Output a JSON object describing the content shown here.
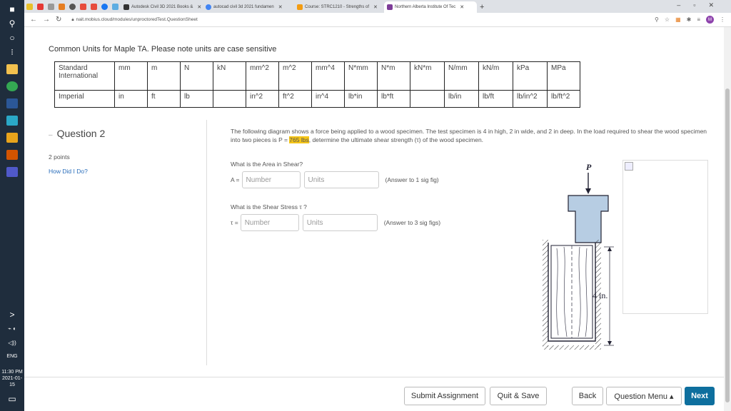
{
  "taskbar": {
    "icons": [
      "windows-start",
      "search",
      "task-view",
      "apps-grid",
      "file-explorer",
      "chrome",
      "word",
      "civil3d",
      "pdf",
      "store",
      "teams"
    ],
    "tray_chevron": ">",
    "lang": "ENG",
    "time": "11:30 PM",
    "date": "2021-01-15"
  },
  "browser": {
    "tabs": [
      {
        "label": "Autodesk Civil 3D 2021 Books &"
      },
      {
        "label": "autocad civil 3d 2021 fundamen"
      },
      {
        "label": "Course: STRC1210 - Strengths of"
      },
      {
        "label": "Northern Alberta Institute Of Tec"
      }
    ],
    "new_tab": "+",
    "url": "nait.mobius.cloud/modules/unproctoredTest.QuestionSheet",
    "profile_initial": "M"
  },
  "units": {
    "heading": "Common Units for Maple TA. Please note units are case sensitive",
    "standard": {
      "label": "Standard International",
      "cells": [
        "mm",
        "m",
        "N",
        "kN",
        "mm^2",
        "m^2",
        "mm^4",
        "N*mm",
        "N*m",
        "kN*m",
        "N/mm",
        "kN/m",
        "kPa",
        "MPa"
      ]
    },
    "imperial": {
      "label": "Imperial",
      "cells": [
        "in",
        "ft",
        "lb",
        "",
        "in^2",
        "ft^2",
        "in^4",
        "lb*in",
        "lb*ft",
        "",
        "lb/in",
        "lb/ft",
        "lb/in^2",
        "lb/ft^2"
      ]
    }
  },
  "question": {
    "dash": "–",
    "title": "Question 2",
    "points": "2 points",
    "how_did_i_do": "How Did I Do?",
    "body_pre": "The following diagram shows a force being applied to a wood specimen. The test specimen is 4 in high, 2 in wide, and 2 in deep. In the load required to shear the wood specimen into two pieces is P = ",
    "body_highlight": "765 lbs",
    "body_post": ", determine the ultimate shear strength (τ) of the wood specimen.",
    "parts": [
      {
        "prompt": "What is the Area in Shear?",
        "symbol": "A =",
        "number_placeholder": "Number",
        "units_placeholder": "Units",
        "note": "(Answer to 1 sig fig)"
      },
      {
        "prompt": "What is the Shear Stress τ ?",
        "symbol": "τ =",
        "number_placeholder": "Number",
        "units_placeholder": "Units",
        "note": "(Answer to 3 sig figs)"
      }
    ],
    "diagram": {
      "load_label": "P",
      "height_label": "4 in."
    }
  },
  "footer": {
    "submit": "Submit Assignment",
    "quit": "Quit & Save",
    "back": "Back",
    "menu": "Question Menu ▴",
    "next": "Next"
  },
  "colors": {
    "primary_button": "#0e6f9e",
    "highlight": "#f5c518",
    "link": "#2a6ebb"
  }
}
